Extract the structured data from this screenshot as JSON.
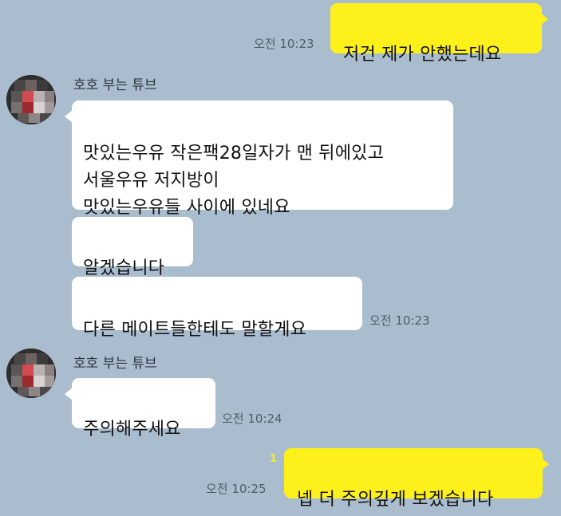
{
  "colors": {
    "background": "#a9bdce",
    "my_bubble": "#fef01b",
    "their_bubble": "#ffffff",
    "time_text": "#4f5d69",
    "unread_count": "#fef01b"
  },
  "conversation": {
    "messages": [
      {
        "sender": "me",
        "text": "저건 제가 안했는데요",
        "time": "오전 10:23"
      },
      {
        "sender": "호호 부는 튜브",
        "avatar_icon": "pixelated-avatar-icon",
        "texts": [
          "맛있는우유 작은팩28일자가 맨 뒤에있고\n서울우유 저지방이\n맛있는우유들 사이에 있네요",
          "알겠습니다",
          "다른 메이트들한테도 말할게요"
        ],
        "time": "오전 10:23"
      },
      {
        "sender": "호호 부는 튜브",
        "avatar_icon": "pixelated-avatar-icon",
        "texts": [
          "주의해주세요"
        ],
        "time": "오전 10:24"
      },
      {
        "sender": "me",
        "text": "넵 더 주의깊게 보겠습니다",
        "unread": "1",
        "time": "오전 10:25"
      }
    ]
  }
}
